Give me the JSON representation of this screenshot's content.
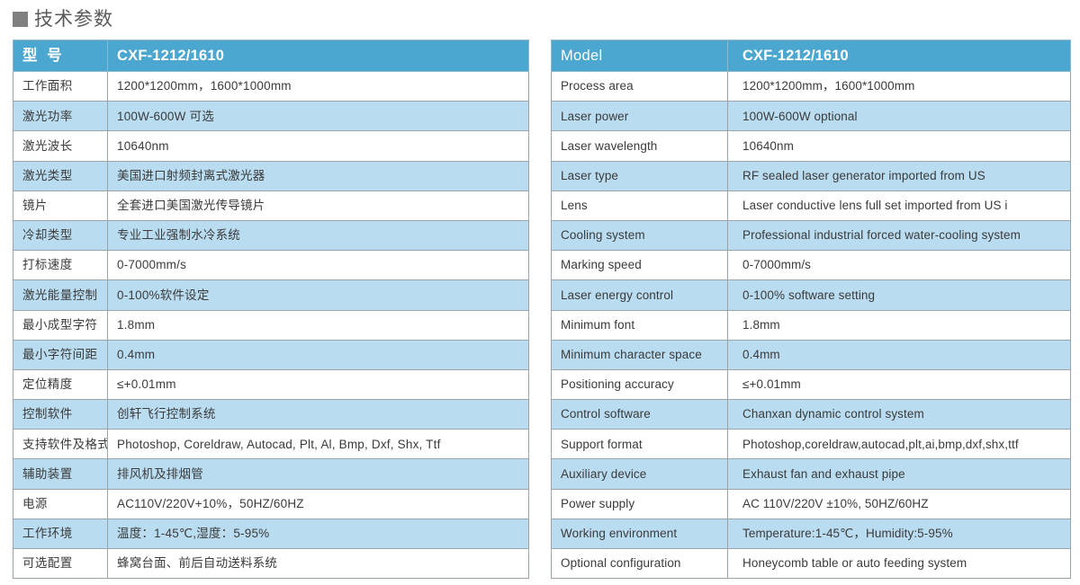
{
  "page": {
    "title_icon": "square-bullet-icon",
    "title": "技术参数"
  },
  "tables": [
    {
      "id": "left",
      "lang": "zh",
      "header": {
        "label": "型 号",
        "value": "CXF-1212/1610"
      },
      "rows": [
        {
          "label": "工作面积",
          "value": "1200*1200mm，1600*1000mm"
        },
        {
          "label": "激光功率",
          "value": "100W-600W 可选"
        },
        {
          "label": "激光波长",
          "value": "10640nm"
        },
        {
          "label": "激光类型",
          "value": "美国进口射频封离式激光器"
        },
        {
          "label": "镜片",
          "value": "全套进口美国激光传导镜片"
        },
        {
          "label": "冷却类型",
          "value": "专业工业强制水冷系统"
        },
        {
          "label": "打标速度",
          "value": "0-7000mm/s"
        },
        {
          "label": "激光能量控制",
          "value": "0-100%软件设定"
        },
        {
          "label": "最小成型字符",
          "value": "1.8mm"
        },
        {
          "label": "最小字符间距",
          "value": "0.4mm"
        },
        {
          "label": "定位精度",
          "value": "≤+0.01mm"
        },
        {
          "label": "控制软件",
          "value": "创轩飞行控制系统"
        },
        {
          "label": "支持软件及格式",
          "value": "Photoshop, Coreldraw, Autocad, Plt, Al, Bmp, Dxf, Shx, Ttf"
        },
        {
          "label": "辅助装置",
          "value": "排风机及排烟管"
        },
        {
          "label": "电源",
          "value": "AC110V/220V+10%，50HZ/60HZ"
        },
        {
          "label": "工作环境",
          "value": "温度：1-45℃,湿度：5-95%"
        },
        {
          "label": "可选配置",
          "value": "蜂窝台面、前后自动送料系统"
        }
      ]
    },
    {
      "id": "right",
      "lang": "en",
      "header": {
        "label": "Model",
        "value": "CXF-1212/1610"
      },
      "rows": [
        {
          "label": "Process area",
          "value": "1200*1200mm，1600*1000mm"
        },
        {
          "label": "Laser power",
          "value": "100W-600W optional"
        },
        {
          "label": "Laser wavelength",
          "value": "10640nm"
        },
        {
          "label": "Laser type",
          "value": "RF sealed laser generator imported from US"
        },
        {
          "label": "Lens",
          "value": "Laser conductive lens full set imported from US i"
        },
        {
          "label": "Cooling system",
          "value": "Professional industrial forced water-cooling system"
        },
        {
          "label": "Marking speed",
          "value": "0-7000mm/s"
        },
        {
          "label": "Laser energy control",
          "value": "0-100% software setting"
        },
        {
          "label": "Minimum  font",
          "value": "1.8mm"
        },
        {
          "label": "Minimum character space",
          "value": "0.4mm"
        },
        {
          "label": "Positioning accuracy",
          "value": "≤+0.01mm"
        },
        {
          "label": "Control software",
          "value": "Chanxan dynamic control system"
        },
        {
          "label": "Support format",
          "value": "Photoshop,coreldraw,autocad,plt,ai,bmp,dxf,shx,ttf"
        },
        {
          "label": "Auxiliary device",
          "value": "Exhaust fan and exhaust pipe"
        },
        {
          "label": "Power supply",
          "value": "AC 110V/220V ±10%, 50HZ/60HZ"
        },
        {
          "label": "Working environment",
          "value": "Temperature:1-45℃，Humidity:5-95%"
        },
        {
          "label": "Optional configuration",
          "value": "Honeycomb table or auto feeding system"
        }
      ]
    }
  ],
  "colors": {
    "header_blue": "#4ba6d0",
    "row_light_blue": "#b9dcf0",
    "row_white": "#ffffff",
    "border_gray": "#9aa3a8",
    "text_gray": "#3b3b3b",
    "title_gray": "#5a5a5a",
    "title_square_gray": "#808080"
  }
}
